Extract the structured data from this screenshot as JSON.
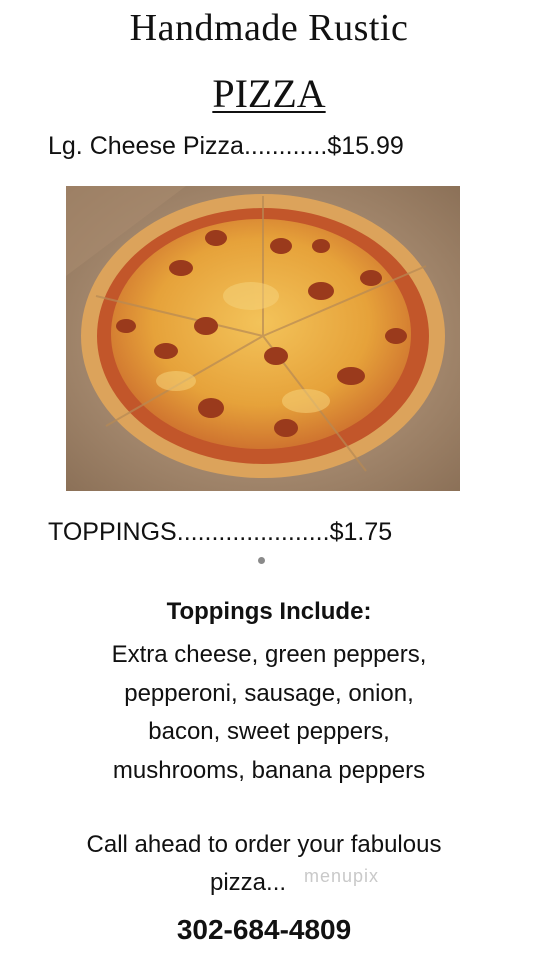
{
  "header": {
    "line1": "Handmade Rustic",
    "line2": "PIZZA"
  },
  "cheese_pizza": {
    "label": "Lg. Cheese Pizza",
    "leader": "............",
    "price": "$15.99"
  },
  "toppings_price": {
    "label": "TOPPINGS",
    "leader": "......................",
    "price": "$1.75"
  },
  "toppings_include": {
    "heading": "Toppings Include:",
    "lines": [
      "Extra cheese, green peppers,",
      "pepperoni, sausage, onion,",
      "bacon, sweet peppers,",
      "mushrooms, banana peppers"
    ]
  },
  "call_ahead": {
    "line1": "Call ahead to order your fabulous",
    "line2": "pizza..."
  },
  "watermark": "menupix",
  "phone": "302-684-4809",
  "colors": {
    "text": "#111111",
    "box_cardboard": "#b39578",
    "crust": "#d9a55a",
    "cheese": "#e7a33b",
    "sauce": "#c2562a",
    "pepperoni": "#9a3a1c"
  }
}
